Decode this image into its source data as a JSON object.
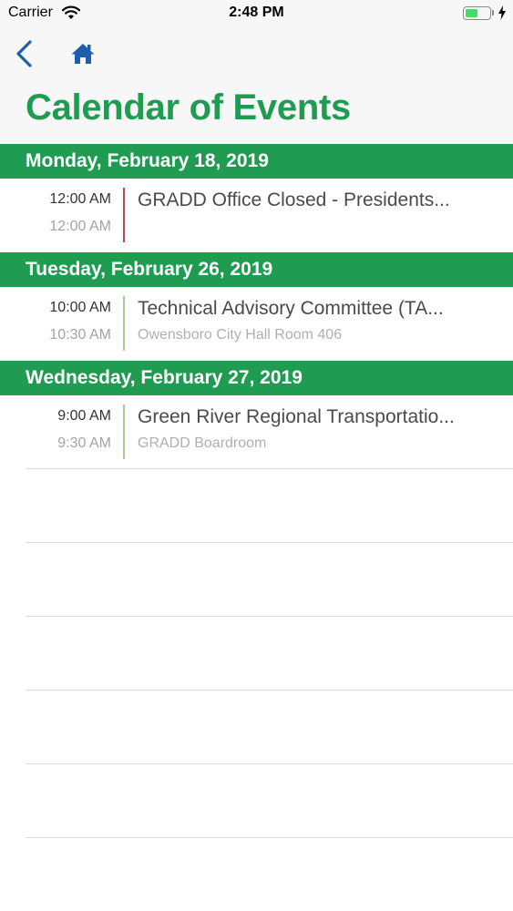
{
  "status_bar": {
    "carrier": "Carrier",
    "time": "2:48 PM",
    "battery_level": 0.55,
    "battery_color": "#4cd964",
    "icons": [
      "wifi-icon",
      "battery-icon",
      "charging-bolt-icon"
    ]
  },
  "nav": {
    "back_icon": "chevron-left-icon",
    "home_icon": "home-icon",
    "icon_color": "#1d5fa8"
  },
  "page_title": "Calendar of Events",
  "colors": {
    "brand_green": "#1f9c52",
    "closed_event_accent": "#b5495b",
    "event_accent": "#a8d08d"
  },
  "sections": [
    {
      "date": "Monday, February 18, 2019",
      "events": [
        {
          "start": "12:00 AM",
          "end": "12:00 AM",
          "title": "GRADD Office Closed - Presidents...",
          "location": "",
          "accent": "#b5495b"
        }
      ]
    },
    {
      "date": "Tuesday, February 26, 2019",
      "events": [
        {
          "start": "10:00 AM",
          "end": "10:30 AM",
          "title": "Technical Advisory Committee (TA...",
          "location": "Owensboro City Hall Room 406",
          "accent": "#a8d08d"
        }
      ]
    },
    {
      "date": "Wednesday, February 27, 2019",
      "events": [
        {
          "start": "9:00 AM",
          "end": "9:30 AM",
          "title": "Green River Regional Transportatio...",
          "location": "GRADD Boardroom",
          "accent": "#a8d08d"
        }
      ]
    }
  ]
}
